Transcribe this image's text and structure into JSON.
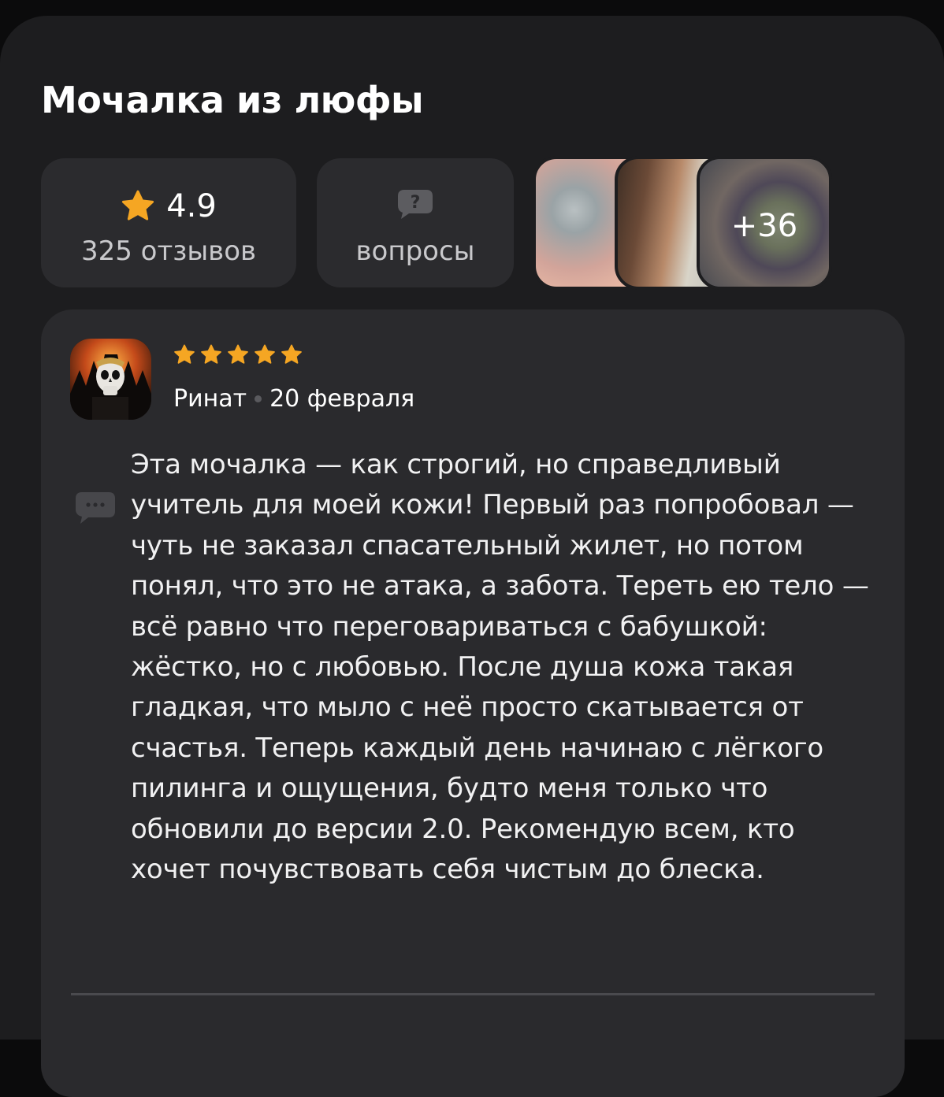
{
  "product": {
    "title": "Мочалка из люфы"
  },
  "rating_card": {
    "rating": "4.9",
    "reviews_label": "325 отзывов",
    "icon": "star-icon",
    "accent": "#f5a623"
  },
  "questions_card": {
    "label": "вопросы",
    "icon": "question-bubble-icon"
  },
  "photos": {
    "more_count": "+36"
  },
  "review": {
    "author": "Ринат",
    "date": "20 февраля",
    "stars": 5,
    "text": "Эта мочалка — как строгий, но справедливый учитель для моей кожи! Первый раз попробовал — чуть не заказал спасательный жилет, но потом понял, что это не атака, а забота. Тереть ею тело — всё равно что переговариваться с бабушкой: жёстко, но с любовью. После душа кожа такая гладкая, что мыло с неё просто скатывается от счастья. Теперь каждый день начинаю с лёгкого пилинга и ощущения, будто меня только что обновили до версии 2.0. Рекомендую всем, кто хочет почувствовать себя чистым до блеска.",
    "comment_icon": "comment-icon"
  },
  "colors": {
    "background": "#1d1d1f",
    "card": "#2a2a2d",
    "star": "#f5a623",
    "text": "#ffffff"
  }
}
